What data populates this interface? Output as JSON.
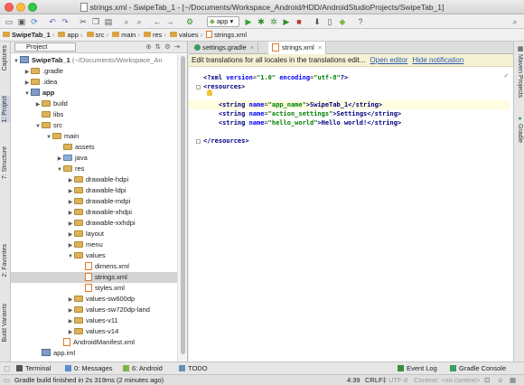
{
  "window": {
    "file": "strings.xml",
    "title_rest": " - SwipeTab_1 - [~/Documents/Workspace_Android/HDD/AndroidStudioProjects/SwipeTab_1]"
  },
  "toolbar": {
    "run_config": "app",
    "icons": [
      "open-folder",
      "save",
      "sync",
      "undo",
      "redo",
      "cut",
      "copy",
      "paste",
      "find",
      "replace",
      "back",
      "forward",
      "make",
      "run",
      "debug",
      "attach",
      "coverage",
      "stop",
      "sdk-manager",
      "avd-manager",
      "device-monitor",
      "help",
      "search"
    ]
  },
  "breadcrumbs": [
    "SwipeTab_1",
    "app",
    "src",
    "main",
    "res",
    "values",
    "strings.xml"
  ],
  "left_tabs": {
    "captures": "Captures",
    "project": "1: Project",
    "structure": "7: Structure",
    "favorites": "2: Favorites",
    "build_variants": "Build Variants"
  },
  "right_tabs": {
    "maven": "Maven Projects",
    "gradle": "Gradle"
  },
  "project_panel": {
    "view_mode": "Project",
    "tree": [
      {
        "label": "SwipeTab_1",
        "suffix": " (~/Documents/Workspace_An",
        "kind": "module",
        "toggle": "▼",
        "bold": true
      },
      {
        "label": ".gradle",
        "kind": "folder",
        "toggle": "▶"
      },
      {
        "label": ".idea",
        "kind": "folder",
        "toggle": "▶"
      },
      {
        "label": "app",
        "kind": "module",
        "toggle": "▼",
        "bold": true
      },
      {
        "label": "build",
        "kind": "folder",
        "toggle": "▶"
      },
      {
        "label": "libs",
        "kind": "folder",
        "toggle": ""
      },
      {
        "label": "src",
        "kind": "folder",
        "toggle": "▼"
      },
      {
        "label": "main",
        "kind": "folder",
        "toggle": "▼"
      },
      {
        "label": "assets",
        "kind": "folder",
        "toggle": ""
      },
      {
        "label": "java",
        "kind": "folder-blue",
        "toggle": "▶"
      },
      {
        "label": "res",
        "kind": "folder",
        "toggle": "▼"
      },
      {
        "label": "drawable-hdpi",
        "kind": "folder",
        "toggle": "▶"
      },
      {
        "label": "drawable-ldpi",
        "kind": "folder",
        "toggle": "▶"
      },
      {
        "label": "drawable-mdpi",
        "kind": "folder",
        "toggle": "▶"
      },
      {
        "label": "drawable-xhdpi",
        "kind": "folder",
        "toggle": "▶"
      },
      {
        "label": "drawable-xxhdpi",
        "kind": "folder",
        "toggle": "▶"
      },
      {
        "label": "layout",
        "kind": "folder",
        "toggle": "▶"
      },
      {
        "label": "menu",
        "kind": "folder",
        "toggle": "▶"
      },
      {
        "label": "values",
        "kind": "folder",
        "toggle": "▼"
      },
      {
        "label": "dimens.xml",
        "kind": "xml",
        "toggle": ""
      },
      {
        "label": "strings.xml",
        "kind": "xml",
        "toggle": "",
        "selected": true
      },
      {
        "label": "styles.xml",
        "kind": "xml",
        "toggle": ""
      },
      {
        "label": "values-sw600dp",
        "kind": "folder",
        "toggle": "▶"
      },
      {
        "label": "values-sw720dp-land",
        "kind": "folder",
        "toggle": "▶"
      },
      {
        "label": "values-v11",
        "kind": "folder",
        "toggle": "▶"
      },
      {
        "label": "values-v14",
        "kind": "folder",
        "toggle": "▶"
      },
      {
        "label": "AndroidManifest.xml",
        "kind": "xml",
        "toggle": ""
      },
      {
        "label": "app.iml",
        "kind": "module-file",
        "toggle": ""
      }
    ]
  },
  "editor": {
    "tabs": [
      {
        "label": "settings.gradle",
        "active": false
      },
      {
        "label": "strings.xml",
        "active": true
      }
    ],
    "banner": {
      "text": "Edit translations for all locales in the translations edit...",
      "open_editor": "Open editor",
      "hide_notification": "Hide notification"
    }
  },
  "code": {
    "line1": {
      "a": "<?xml ",
      "b": "version",
      "c": "=",
      "d": "\"1.0\"",
      "e": " encoding",
      "f": "=",
      "g": "\"utf-8\"",
      "h": "?>"
    },
    "line2": "<resources>",
    "line4": {
      "open": "<string ",
      "attr": "name",
      "eq": "=",
      "val": "\"app_name\"",
      "text": ">SwipeTab_1</string>"
    },
    "line5": {
      "open": "<string ",
      "attr": "name",
      "eq": "=",
      "val": "\"action_settings\"",
      "text": ">Settings</string>"
    },
    "line6": {
      "open": "<string ",
      "attr": "name",
      "eq": "=",
      "val": "\"hello_world\"",
      "text": ">Hello world!</string>"
    },
    "line8": "</resources>"
  },
  "bottom_tabs": [
    "Terminal",
    "0: Messages",
    "6: Android",
    "TODO"
  ],
  "bottom_tabs_right": [
    "Event Log",
    "Gradle Console"
  ],
  "status": {
    "message": "Gradle build finished in 2s 319ms (2 minutes ago)",
    "position": "4:39",
    "line_sep": "CRLF",
    "encoding": "UTF-8",
    "context": "Context: <no context>"
  }
}
